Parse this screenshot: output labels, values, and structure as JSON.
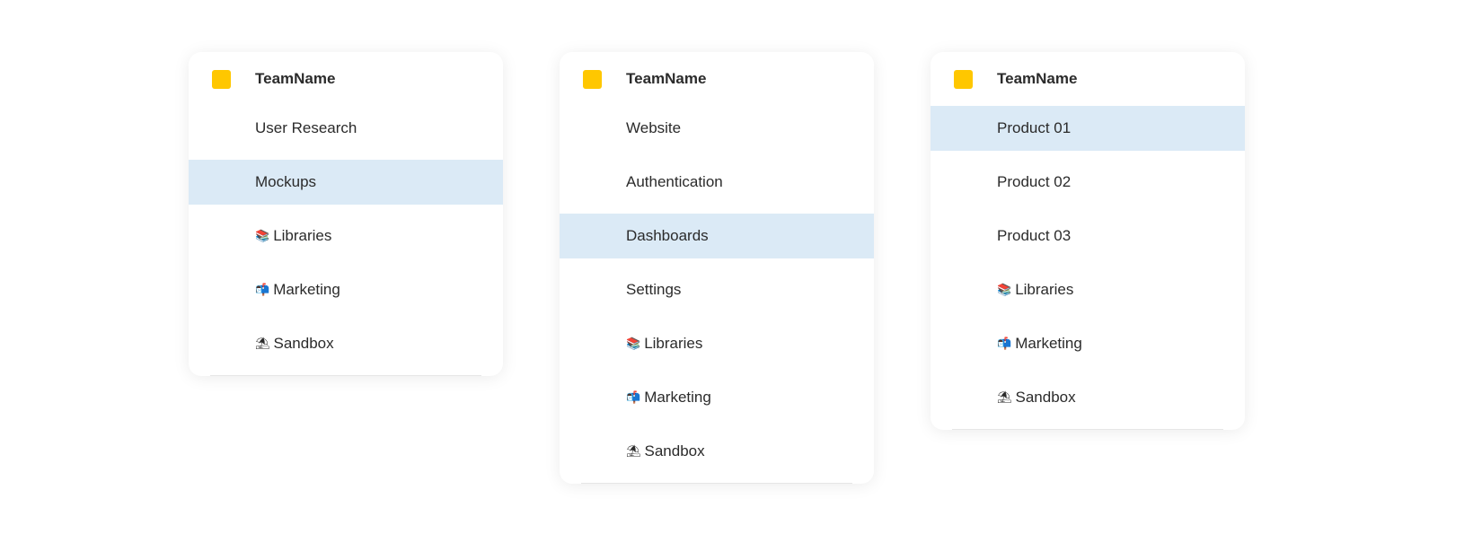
{
  "panels": [
    {
      "team_name": "TeamName",
      "swatch_color": "#FFC700",
      "active_index": 1,
      "items": [
        {
          "emoji": "",
          "label": "User Research"
        },
        {
          "emoji": "",
          "label": "Mockups"
        },
        {
          "emoji": "📚",
          "label": "Libraries"
        },
        {
          "emoji": "📬",
          "label": "Marketing"
        },
        {
          "emoji": "⛱",
          "label": "Sandbox"
        }
      ]
    },
    {
      "team_name": "TeamName",
      "swatch_color": "#FFC700",
      "active_index": 2,
      "items": [
        {
          "emoji": "",
          "label": "Website"
        },
        {
          "emoji": "",
          "label": "Authentication"
        },
        {
          "emoji": "",
          "label": "Dashboards"
        },
        {
          "emoji": "",
          "label": "Settings"
        },
        {
          "emoji": "📚",
          "label": "Libraries"
        },
        {
          "emoji": "📬",
          "label": "Marketing"
        },
        {
          "emoji": "⛱",
          "label": "Sandbox"
        }
      ]
    },
    {
      "team_name": "TeamName",
      "swatch_color": "#FFC700",
      "active_index": 0,
      "items": [
        {
          "emoji": "",
          "label": "Product 01"
        },
        {
          "emoji": "",
          "label": "Product 02"
        },
        {
          "emoji": "",
          "label": "Product 03"
        },
        {
          "emoji": "📚",
          "label": "Libraries"
        },
        {
          "emoji": "📬",
          "label": "Marketing"
        },
        {
          "emoji": "⛱",
          "label": "Sandbox"
        }
      ]
    }
  ],
  "colors": {
    "active_row": "#DBEAF6",
    "team_swatch": "#FFC700",
    "text": "#2b2b2b"
  }
}
